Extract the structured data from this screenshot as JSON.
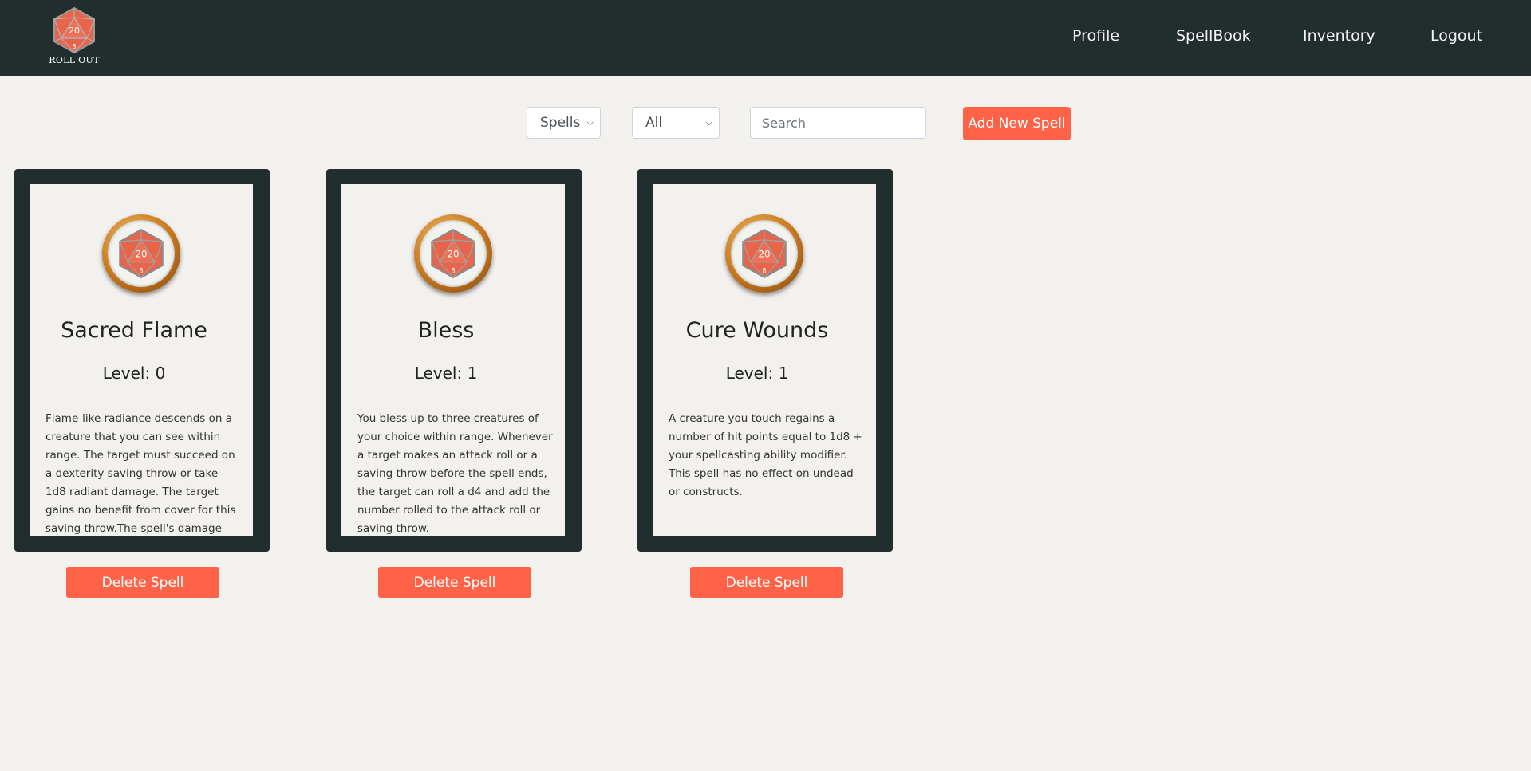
{
  "brand": {
    "name": "ROLL OUT",
    "icon": "d20-dice-icon",
    "accent": "#ff6347"
  },
  "nav": {
    "items": [
      {
        "label": "Profile"
      },
      {
        "label": "SpellBook"
      },
      {
        "label": "Inventory"
      },
      {
        "label": "Logout"
      }
    ]
  },
  "toolbar": {
    "type_select": "Spells",
    "level_select": "All",
    "search_placeholder": "Search",
    "add_label": "Add New Spell"
  },
  "cards": [
    {
      "name": "Sacred Flame",
      "level": "Level: 0",
      "description": "Flame-like radiance descends on a creature that you can see within range. The target must succeed on a dexterity saving throw or take 1d8 radiant damage. The target gains no benefit from cover for this saving throw.The spell's damage",
      "delete_label": "Delete Spell"
    },
    {
      "name": "Bless",
      "level": "Level: 1",
      "description": "You bless up to three creatures of your choice within range. Whenever a target makes an attack roll or a saving throw before the spell ends, the target can roll a d4 and add the number rolled to the attack roll or saving throw.",
      "delete_label": "Delete Spell"
    },
    {
      "name": "Cure Wounds",
      "level": "Level: 1",
      "description": "A creature you touch regains a number of hit points equal to 1d8 + your spellcasting ability modifier. This spell has no effect on undead or constructs.",
      "delete_label": "Delete Spell"
    }
  ]
}
